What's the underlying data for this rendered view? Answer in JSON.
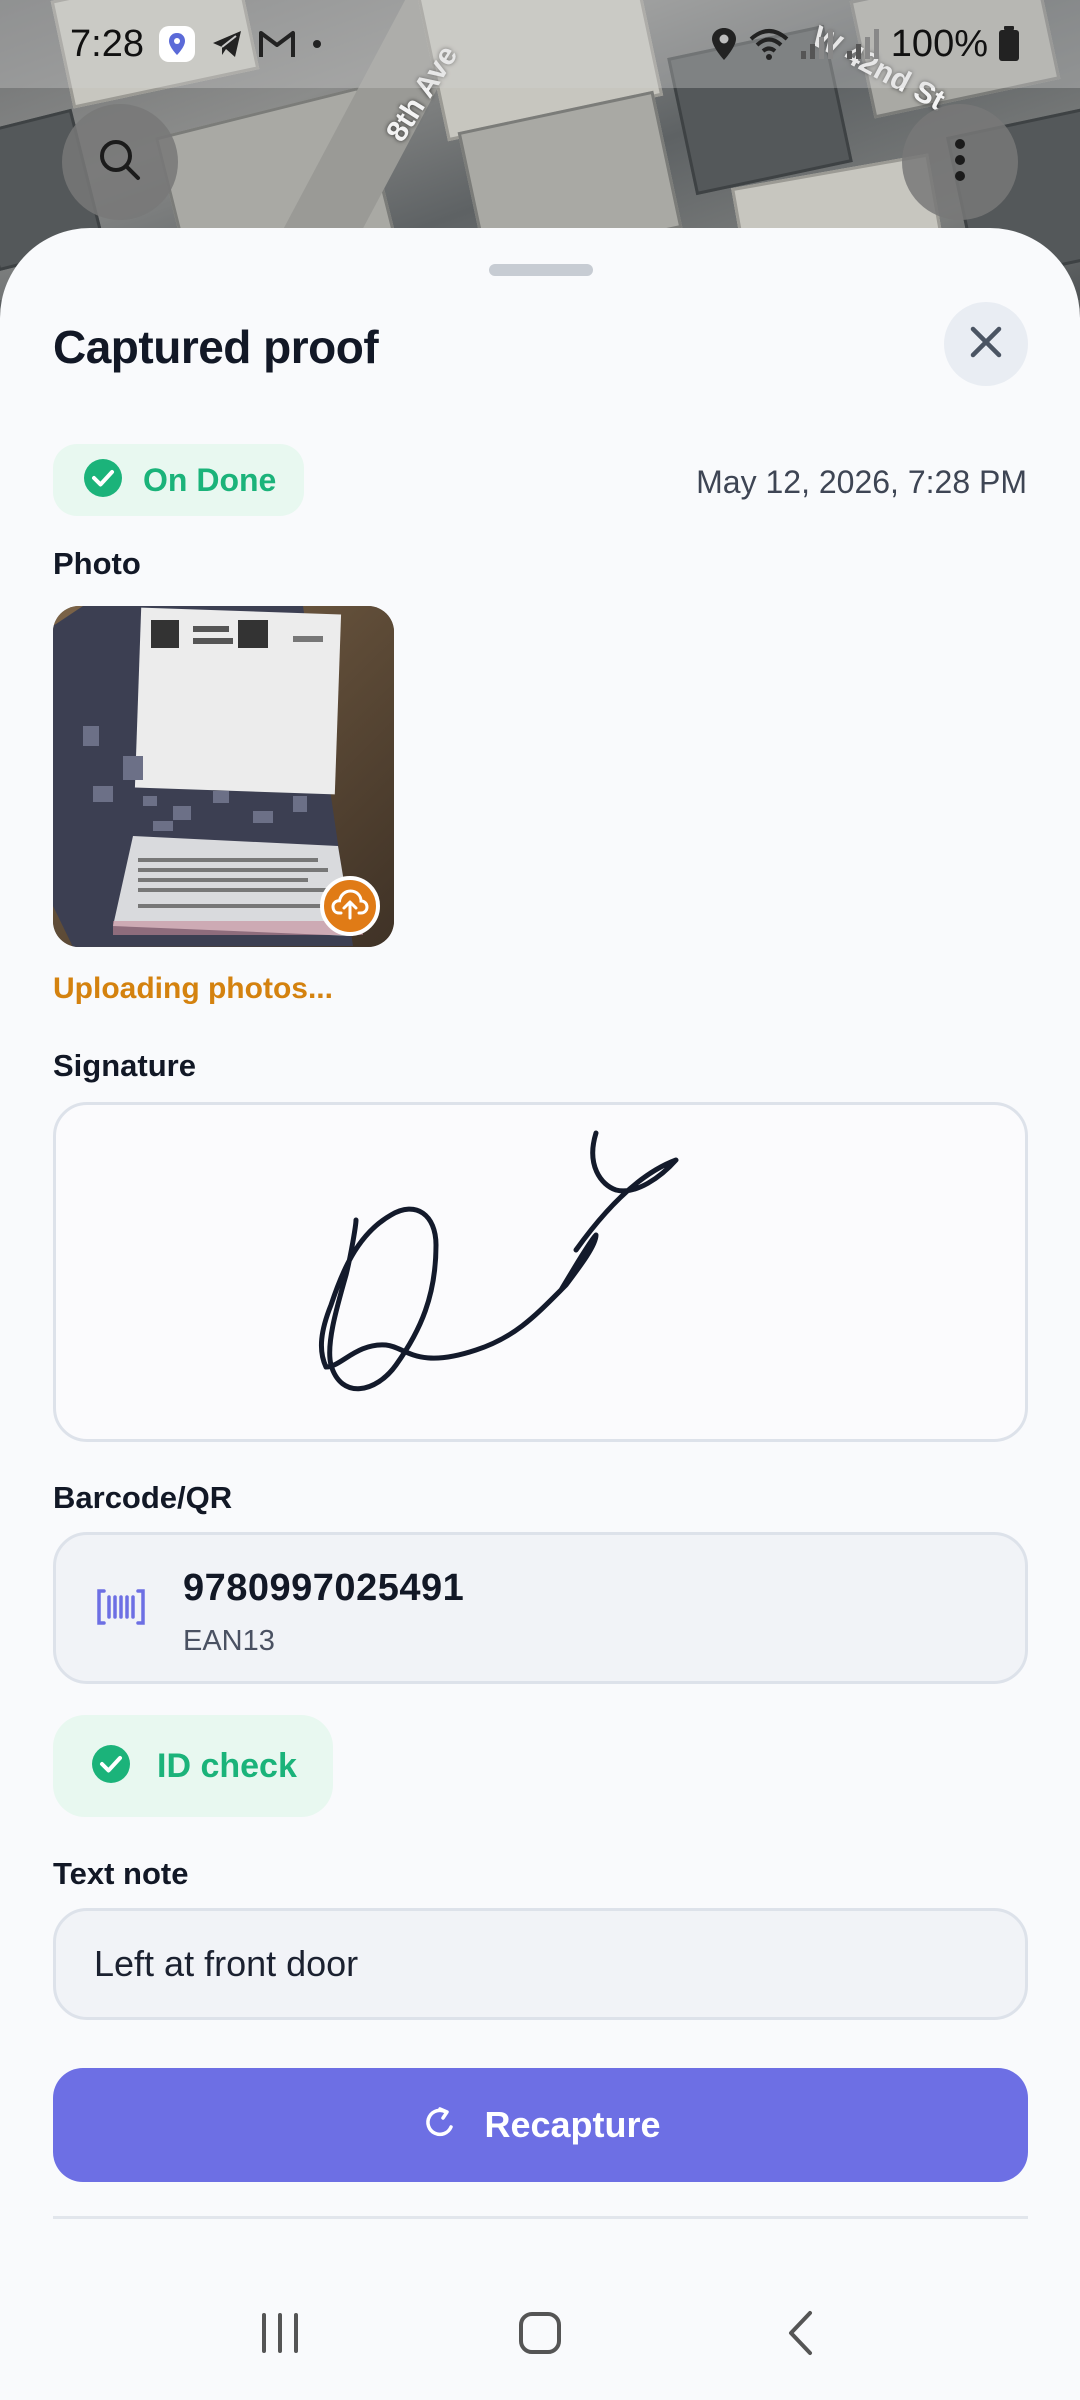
{
  "status_bar": {
    "time": "7:28",
    "battery": "100%",
    "left_icons": [
      "maps-pin-icon",
      "telegram-icon",
      "gmail-icon",
      "dot-icon"
    ],
    "right_icons": [
      "location-icon",
      "wifi-icon",
      "signal-icon",
      "signal-icon",
      "battery-icon"
    ]
  },
  "map": {
    "street_labels": [
      "8th Ave",
      "W 42nd St"
    ]
  },
  "sheet": {
    "title": "Captured proof",
    "status_chip": "On Done",
    "timestamp": "May 12, 2026, 7:28 PM",
    "photo_label": "Photo",
    "uploading_text": "Uploading photos...",
    "signature_label": "Signature",
    "barcode_label": "Barcode/QR",
    "barcode_value": "9780997025491",
    "barcode_type": "EAN13",
    "id_check_label": "ID check",
    "text_note_label": "Text note",
    "text_note_value": "Left at front door",
    "recapture_label": "Recapture"
  },
  "colors": {
    "accent": "#6d6fe4",
    "success": "#1bb37a",
    "success_bg": "#e8f8f0",
    "warning": "#d4820f"
  }
}
